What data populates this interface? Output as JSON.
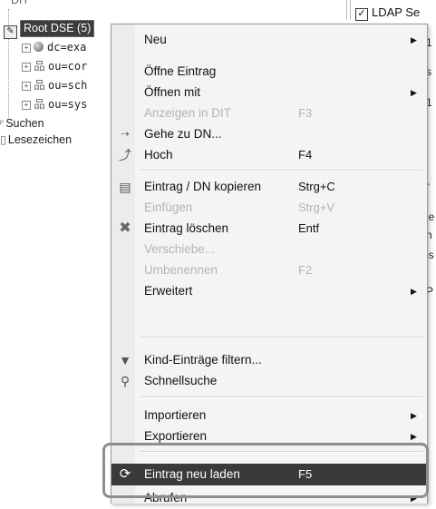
{
  "tree": {
    "top_label": "DIT",
    "root_label": "Root DSE (5)",
    "children": [
      "dc=exa",
      "ou=cor",
      "ou=sch",
      "ou=sys"
    ],
    "searches_label": "Suchen",
    "bookmarks_label": "Lesezeichen"
  },
  "right": {
    "ldap_label": "LDAP Se",
    "fragments": [
      "1",
      "s",
      "1",
      "r",
      "le",
      "n",
      "is",
      "P"
    ]
  },
  "menu": {
    "items": [
      {
        "label": "Neu",
        "shortcut": "",
        "submenu": true,
        "disabled": false,
        "icon": ""
      },
      {
        "label": "Öffne Eintrag",
        "shortcut": "",
        "submenu": false,
        "disabled": false,
        "icon": ""
      },
      {
        "label": "Öffnen mit",
        "shortcut": "",
        "submenu": true,
        "disabled": false,
        "icon": ""
      },
      {
        "label": "Anzeigen in DIT",
        "shortcut": "F3",
        "submenu": false,
        "disabled": true,
        "icon": ""
      },
      {
        "label": "Gehe zu DN...",
        "shortcut": "",
        "submenu": false,
        "disabled": false,
        "icon": "goto-dn-icon"
      },
      {
        "label": "Hoch",
        "shortcut": "F4",
        "submenu": false,
        "disabled": false,
        "icon": "up-icon"
      },
      {
        "label": "Eintrag / DN kopieren",
        "shortcut": "Strg+C",
        "submenu": false,
        "disabled": false,
        "icon": "copy-icon"
      },
      {
        "label": "Einfügen",
        "shortcut": "Strg+V",
        "submenu": false,
        "disabled": true,
        "icon": ""
      },
      {
        "label": "Eintrag löschen",
        "shortcut": "Entf",
        "submenu": false,
        "disabled": false,
        "icon": "delete-icon"
      },
      {
        "label": "Verschiebe...",
        "shortcut": "",
        "submenu": false,
        "disabled": true,
        "icon": ""
      },
      {
        "label": "Umbenennen",
        "shortcut": "F2",
        "submenu": false,
        "disabled": true,
        "icon": ""
      },
      {
        "label": "Erweitert",
        "shortcut": "",
        "submenu": true,
        "disabled": false,
        "icon": ""
      },
      {
        "label": "Kind-Einträge filtern...",
        "shortcut": "",
        "submenu": false,
        "disabled": false,
        "icon": "filter-icon"
      },
      {
        "label": "Schnellsuche",
        "shortcut": "",
        "submenu": false,
        "disabled": false,
        "icon": "quicksearch-icon"
      },
      {
        "label": "Importieren",
        "shortcut": "",
        "submenu": true,
        "disabled": false,
        "icon": ""
      },
      {
        "label": "Exportieren",
        "shortcut": "",
        "submenu": true,
        "disabled": false,
        "icon": ""
      },
      {
        "label": "Eintrag neu laden",
        "shortcut": "F5",
        "submenu": false,
        "disabled": false,
        "icon": "reload-icon",
        "highlighted": true
      },
      {
        "label": "Abrufen",
        "shortcut": "",
        "submenu": true,
        "disabled": false,
        "icon": ""
      }
    ]
  },
  "colors": {
    "menu_bg": "#f4f4f4",
    "highlight_bg": "#3a3a3a",
    "disabled_text": "#b4b4b4",
    "callout_border": "#8e8e8e"
  }
}
